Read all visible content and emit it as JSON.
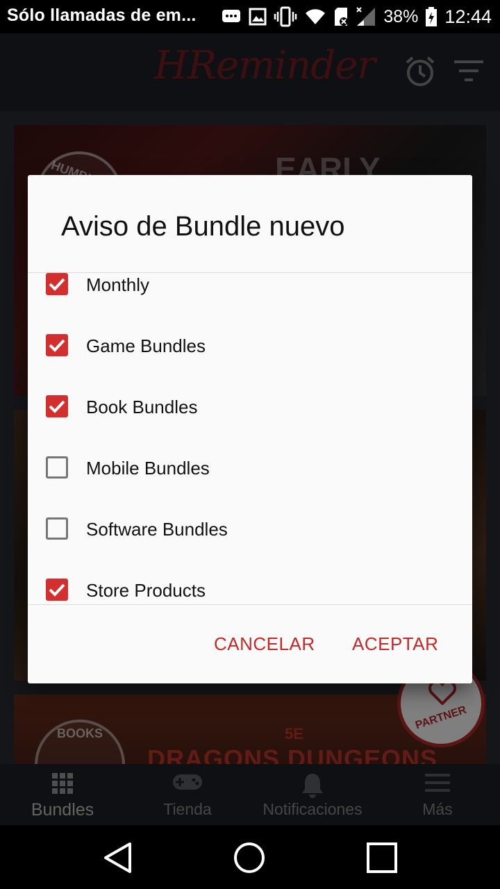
{
  "status_bar": {
    "carrier_text": "Sólo llamadas de em...",
    "battery_percent": "38%",
    "time": "12:44",
    "icons": [
      "message-icon",
      "image-icon",
      "vibrate-icon",
      "wifi-icon",
      "sd-card-icon",
      "signal-icon",
      "battery-icon"
    ]
  },
  "app_bar": {
    "title": "HReminder",
    "actions": [
      "alarm-icon",
      "filter-icon"
    ]
  },
  "background_cards": {
    "card1_badge": "HUMBLE",
    "card1_text": "EARLY",
    "card3_badge": "BOOKS",
    "card3_tag": "5E",
    "card3_title": "DRAGONS DUNGEONS",
    "partner_text": "PARTNER"
  },
  "dialog": {
    "title": "Aviso de Bundle nuevo",
    "options": [
      {
        "label": "Monthly",
        "checked": true
      },
      {
        "label": "Game Bundles",
        "checked": true
      },
      {
        "label": "Book Bundles",
        "checked": true
      },
      {
        "label": "Mobile Bundles",
        "checked": false
      },
      {
        "label": "Software Bundles",
        "checked": false
      },
      {
        "label": "Store Products",
        "checked": true
      }
    ],
    "cancel_label": "CANCELAR",
    "accept_label": "ACEPTAR"
  },
  "bottom_nav": {
    "items": [
      {
        "label": "Bundles",
        "icon": "grid-icon",
        "active": true
      },
      {
        "label": "Tienda",
        "icon": "gamepad-icon",
        "active": false
      },
      {
        "label": "Notificaciones",
        "icon": "bell-icon",
        "active": false
      },
      {
        "label": "Más",
        "icon": "menu-icon",
        "active": false
      }
    ]
  },
  "colors": {
    "accent": "#d32f2f",
    "app_bar": "#1e2126",
    "logo": "#7a1f22"
  }
}
